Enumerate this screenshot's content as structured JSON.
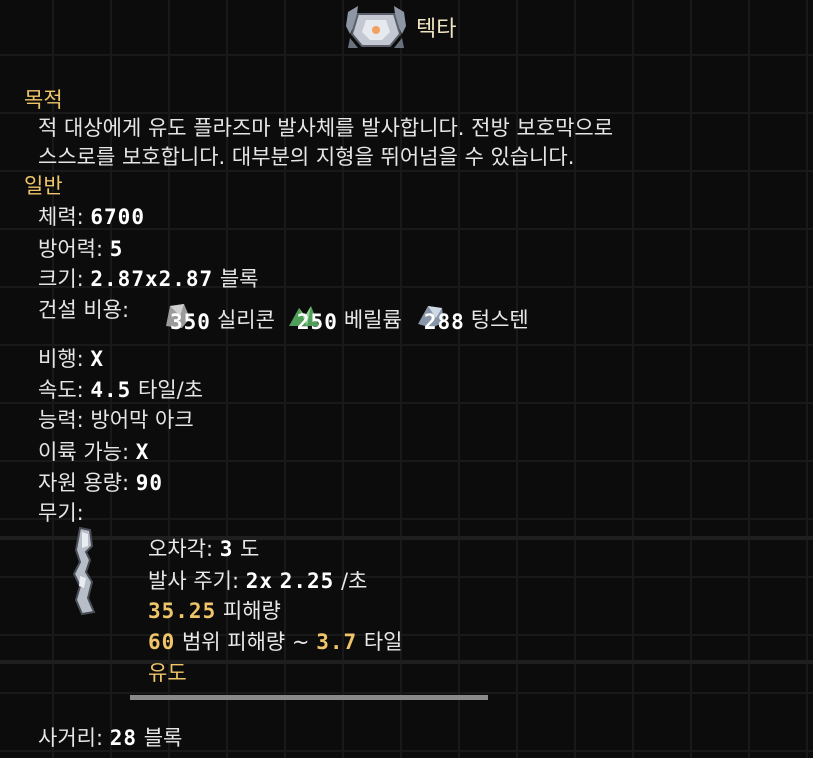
{
  "unit": {
    "name": "텍타",
    "icon": "tecta-mech-icon"
  },
  "purpose": {
    "header": "목적",
    "line1": "적 대상에게 유도 플라즈마 발사체를 발사합니다. 전방 보호막으로",
    "line2": "스스로를 보호합니다. 대부분의 지형을 뛰어넘을 수 있습니다."
  },
  "general": {
    "header": "일반",
    "health_label": "체력: ",
    "health_value": "6700",
    "armor_label": "방어력: ",
    "armor_value": "5",
    "size_label": "크기: ",
    "size_value": "2.87x2.87",
    "size_unit": " 블록",
    "cost_label": "건설 비용:",
    "costs": [
      {
        "amount": "350",
        "name": "실리콘",
        "icon": "silicon-icon",
        "color": "#b9b9b9"
      },
      {
        "amount": "250",
        "name": "베릴륨",
        "icon": "beryllium-icon",
        "color": "#5fb46a"
      },
      {
        "amount": "288",
        "name": "텅스텐",
        "icon": "tungsten-icon",
        "color": "#a7b6c9"
      }
    ],
    "flying_label": "비행: ",
    "flying_value": "X",
    "speed_label": "속도: ",
    "speed_value": "4.5",
    "speed_unit": " 타일/초",
    "ability_label": "능력: ",
    "ability_value": "방어막 아크",
    "canboost_label": "이륙 가능: ",
    "canboost_value": "X",
    "itemcap_label": "자원 용량: ",
    "itemcap_value": "90",
    "weapons_label": "무기:"
  },
  "weapon": {
    "icon": "tecta-weapon-icon",
    "inaccuracy_label": "오차각: ",
    "inaccuracy_value": "3",
    "inaccuracy_unit": " 도",
    "reload_label": "발사 주기: ",
    "reload_mult": "2x",
    "reload_value": "2.25",
    "reload_unit": " /초",
    "damage_value": "35.25",
    "damage_label": " 피해량",
    "splash_value": "60",
    "splash_label": " 범위 피해량 ~ ",
    "splash_range": "3.7",
    "splash_unit": " 타일",
    "homing_label": "유도"
  },
  "range": {
    "label": "사거리: ",
    "value": "28",
    "unit": " 블록"
  },
  "colors": {
    "accent": "#f0c56a",
    "text": "#e6e6e6",
    "background": "#0b0b0b"
  }
}
